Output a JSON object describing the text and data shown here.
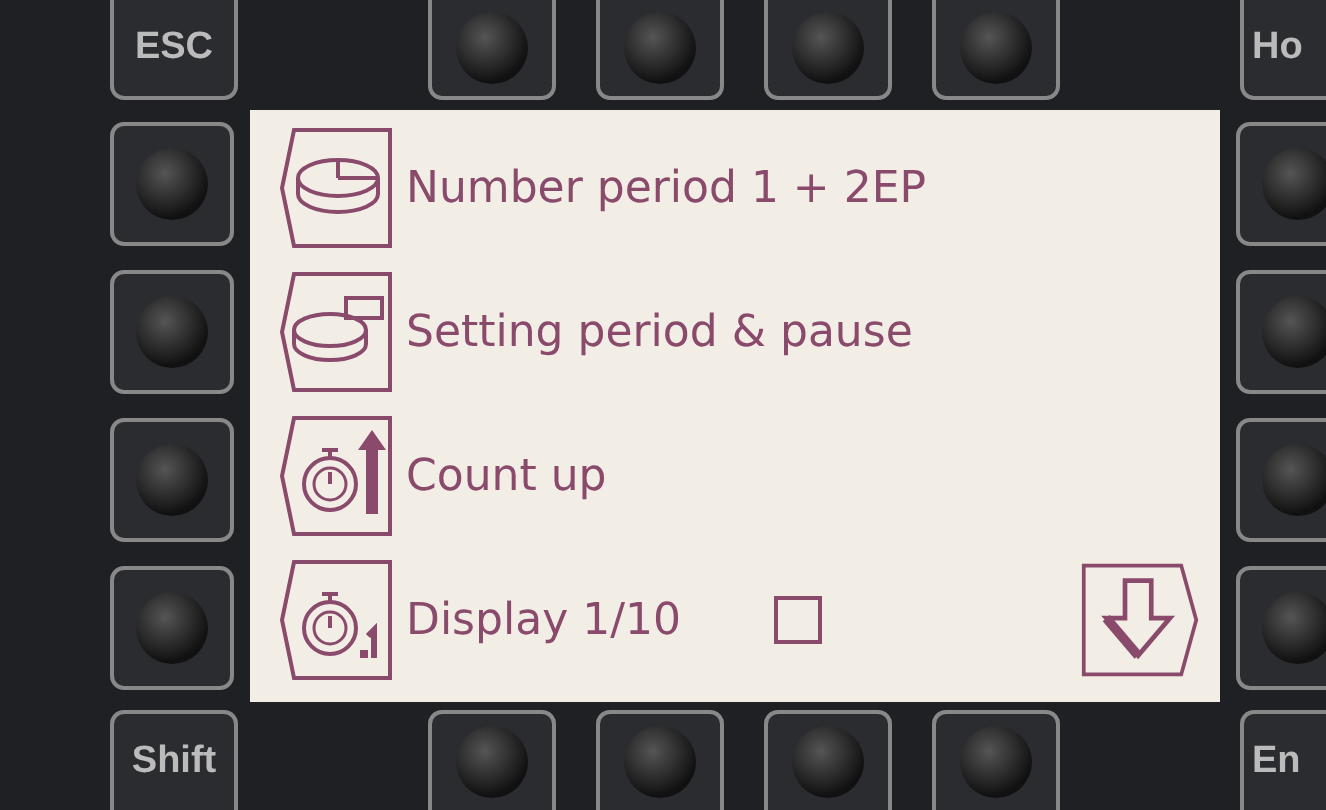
{
  "top_keys": [
    {
      "kind": "label",
      "label": "ESC"
    },
    {
      "kind": "round"
    },
    {
      "kind": "round"
    },
    {
      "kind": "round"
    },
    {
      "kind": "round"
    },
    {
      "kind": "label",
      "label": "Ho"
    }
  ],
  "screen": {
    "items": [
      {
        "kind": "pie",
        "label": "Number period 1 + 2EP"
      },
      {
        "kind": "pie-split",
        "label": "Setting period & pause"
      },
      {
        "kind": "stopwatch-up",
        "label": "Count up"
      },
      {
        "kind": "stopwatch-tenth",
        "label": "Display 1/10",
        "checked": false
      }
    ]
  },
  "bottom_keys": [
    {
      "kind": "label",
      "label": "Shift"
    },
    {
      "kind": "round"
    },
    {
      "kind": "round"
    },
    {
      "kind": "round"
    },
    {
      "kind": "round"
    },
    {
      "kind": "label",
      "label": "En"
    }
  ]
}
